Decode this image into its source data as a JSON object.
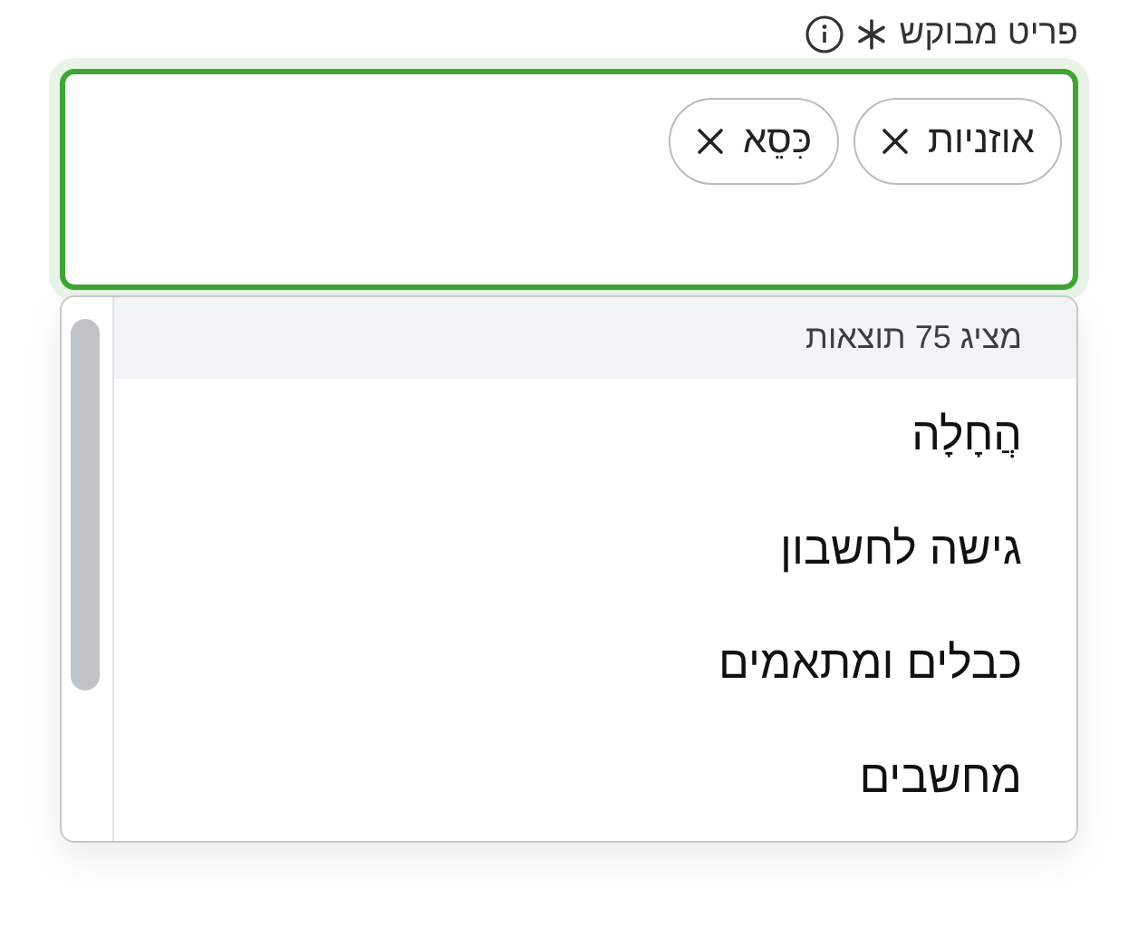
{
  "field": {
    "label": "פריט מבוקש",
    "required": true,
    "focused": true,
    "chips": [
      {
        "label": "אוזניות"
      },
      {
        "label": "כִּסֵא"
      }
    ]
  },
  "dropdown": {
    "count_text": "מציג 75 תוצאות",
    "options": [
      {
        "label": "הֲחָלָה"
      },
      {
        "label": "גישה לחשבון"
      },
      {
        "label": "כבלים ומתאמים"
      },
      {
        "label": "מחשבים"
      }
    ]
  }
}
